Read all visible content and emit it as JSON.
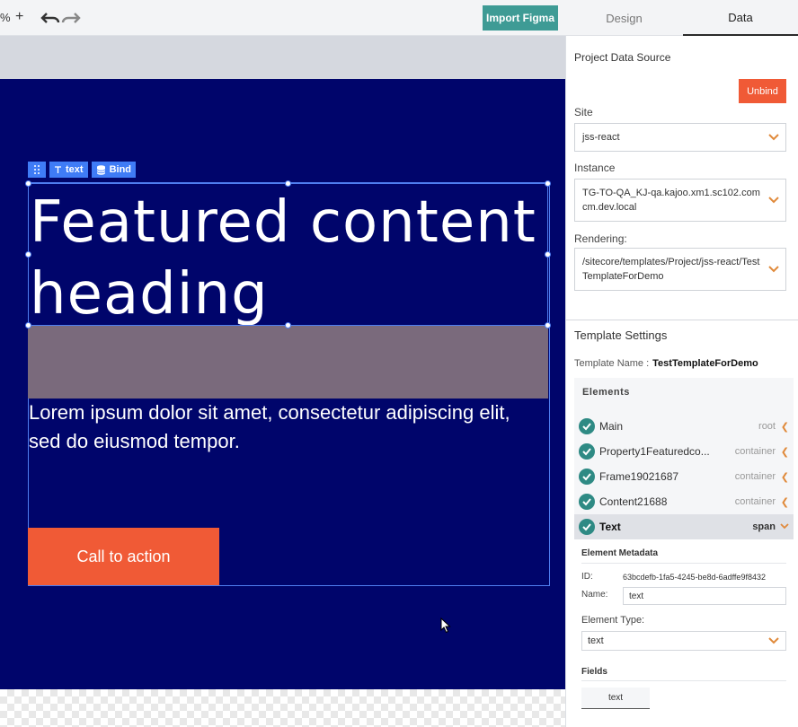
{
  "toolbar": {
    "zoom_suffix": "%",
    "zoom_in": "+",
    "import_figma": "Import Figma",
    "tabs": {
      "design": "Design",
      "data": "Data"
    }
  },
  "canvas": {
    "toolbar": {
      "text_label": "text",
      "bind_label": "Bind"
    },
    "heading": "Featured content heading",
    "body": "Lorem ipsum dolor sit amet, consectetur adipiscing elit, sed do eiusmod tempor.",
    "cta": "Call to action"
  },
  "panel": {
    "project_data_source": "Project Data Source",
    "unbind": "Unbind",
    "site": {
      "label": "Site",
      "value": "jss-react"
    },
    "instance": {
      "label": "Instance",
      "value": "TG-TO-QA_KJ-qa.kajoo.xm1.sc102.comcm.dev.local"
    },
    "rendering": {
      "label": "Rendering:",
      "value": "/sitecore/templates/Project/jss-react/TestTemplateForDemo"
    },
    "template_settings": "Template Settings",
    "template_name_label": "Template Name :",
    "template_name": "TestTemplateForDemo",
    "elements": {
      "header": "Elements",
      "items": [
        {
          "name": "Main",
          "type": "root"
        },
        {
          "name": "Property1Featuredco...",
          "type": "container"
        },
        {
          "name": "Frame19021687",
          "type": "container"
        },
        {
          "name": "Content21688",
          "type": "container"
        },
        {
          "name": "Text",
          "type": "span"
        }
      ]
    },
    "metadata": {
      "title": "Element Metadata",
      "id_label": "ID:",
      "id_value": "63bcdefb-1fa5-4245-be8d-6adffe9f8432",
      "name_label": "Name:",
      "name_value": "text",
      "type_label": "Element Type:",
      "type_value": "text",
      "fields_label": "Fields",
      "field_chip": "text"
    }
  },
  "colors": {
    "canvas_bg": "#00056b",
    "accent_teal": "#3e9b95",
    "accent_orange": "#f05a36",
    "selection_blue": "#4f7ef0"
  }
}
